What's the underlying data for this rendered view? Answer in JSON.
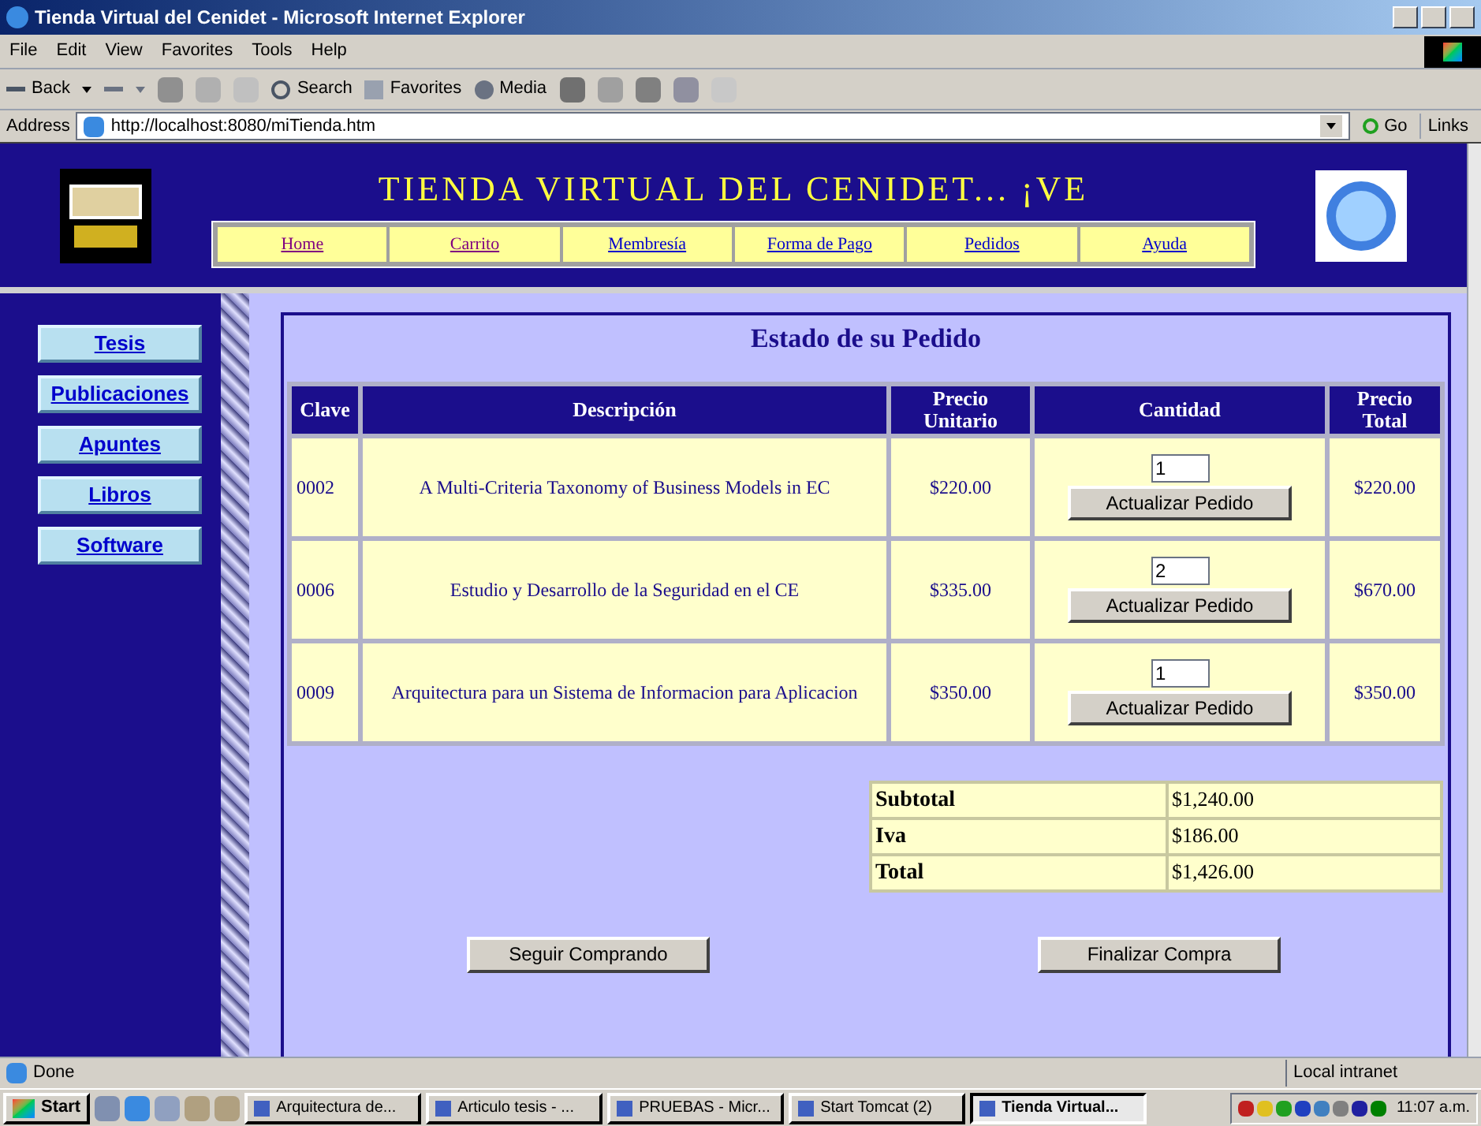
{
  "window": {
    "title": "Tienda Virtual del Cenidet - Microsoft Internet Explorer"
  },
  "menu": [
    "File",
    "Edit",
    "View",
    "Favorites",
    "Tools",
    "Help"
  ],
  "toolbar": {
    "back": "Back",
    "search": "Search",
    "favorites": "Favorites",
    "media": "Media"
  },
  "address": {
    "label": "Address",
    "value": "http://localhost:8080/miTienda.htm",
    "go": "Go",
    "links": "Links"
  },
  "header": {
    "title": "TIENDA VIRTUAL DEL CENIDET... ¡VE",
    "nav": [
      {
        "label": "Home",
        "visited": true
      },
      {
        "label": "Carrito",
        "visited": true
      },
      {
        "label": "Membresía",
        "visited": false
      },
      {
        "label": "Forma de Pago",
        "visited": false
      },
      {
        "label": "Pedidos",
        "visited": false
      },
      {
        "label": "Ayuda",
        "visited": false
      }
    ]
  },
  "sidebar": {
    "items": [
      "Tesis",
      "Publicaciones",
      "Apuntes",
      "Libros",
      "Software"
    ]
  },
  "order": {
    "title": "Estado de su Pedido",
    "columns": [
      "Clave",
      "Descripción",
      "Precio Unitario",
      "Cantidad",
      "Precio Total"
    ],
    "rows": [
      {
        "clave": "0002",
        "descripcion": "A Multi-Criteria Taxonomy of Business Models in EC",
        "unitario": "$220.00",
        "cantidad": "1",
        "update_label": "Actualizar Pedido",
        "total": "$220.00"
      },
      {
        "clave": "0006",
        "descripcion": "Estudio y Desarrollo de la Seguridad en el CE",
        "unitario": "$335.00",
        "cantidad": "2",
        "update_label": "Actualizar Pedido",
        "total": "$670.00"
      },
      {
        "clave": "0009",
        "descripcion": "Arquitectura para un Sistema de Informacion para Aplicacion",
        "unitario": "$350.00",
        "cantidad": "1",
        "update_label": "Actualizar Pedido",
        "total": "$350.00"
      }
    ],
    "totals": [
      {
        "label": "Subtotal",
        "value": "$1,240.00"
      },
      {
        "label": "Iva",
        "value": "$186.00"
      },
      {
        "label": "Total",
        "value": "$1,426.00"
      }
    ],
    "buttons": [
      "Seguir Comprando",
      "Finalizar Compra"
    ]
  },
  "status_bar": {
    "text": "Done",
    "zone": "Local intranet"
  },
  "taskbar": {
    "start": "Start",
    "tasks": [
      {
        "label": "Arquitectura de...",
        "selected": false
      },
      {
        "label": "Articulo tesis - ...",
        "selected": false
      },
      {
        "label": "PRUEBAS - Micr...",
        "selected": false
      },
      {
        "label": "Start Tomcat (2)",
        "selected": false
      },
      {
        "label": "Tienda Virtual...",
        "selected": true
      }
    ],
    "clock": "11:07 a.m."
  }
}
